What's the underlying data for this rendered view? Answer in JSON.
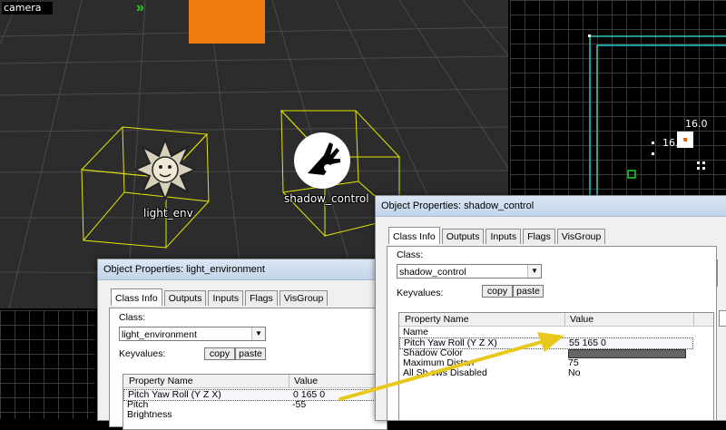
{
  "camera": {
    "label": "camera",
    "entities": [
      {
        "name": "light_env"
      },
      {
        "name": "shadow_control"
      }
    ],
    "colors": {
      "bbox": "#e6e600",
      "brush": "#f07c10",
      "background": "#2c2c2c"
    }
  },
  "ortho_view": {
    "dim_top": "16.0",
    "dim_left": "16.0",
    "colors": {
      "outline": "#25c9c9",
      "grid": "#3a3a3a"
    }
  },
  "dialog_light": {
    "title": "Object Properties: light_environment",
    "tabs": [
      "Class Info",
      "Outputs",
      "Inputs",
      "Flags",
      "VisGroup"
    ],
    "class_label": "Class:",
    "class_value": "light_environment",
    "keyvalues_label": "Keyvalues:",
    "copy_label": "copy",
    "paste_label": "paste",
    "columns": [
      "Property Name",
      "Value"
    ],
    "rows": [
      {
        "name": "Pitch Yaw Roll (Y Z X)",
        "value": "0 165 0",
        "selected": true
      },
      {
        "name": "Pitch",
        "value": "-55"
      },
      {
        "name": "Brightness",
        "value": ""
      }
    ]
  },
  "dialog_shadow": {
    "title": "Object Properties: shadow_control",
    "tabs": [
      "Class Info",
      "Outputs",
      "Inputs",
      "Flags",
      "VisGroup"
    ],
    "class_label": "Class:",
    "class_value": "shadow_control",
    "keyvalues_label": "Keyvalues:",
    "copy_label": "copy",
    "paste_label": "paste",
    "columns": [
      "Property Name",
      "Value"
    ],
    "rows": [
      {
        "name": "Name",
        "value": ""
      },
      {
        "name": "Pitch Yaw Roll (Y Z X)",
        "value": "55 165 0",
        "selected": true
      },
      {
        "name": "Shadow Color",
        "value": "",
        "swatch": "#666666"
      },
      {
        "name": "Maximum Distan",
        "value": "75"
      },
      {
        "name": "All Sh     ows Disabled",
        "value": "No"
      }
    ]
  },
  "annotation": {
    "arrow_color": "#e8c81a"
  }
}
